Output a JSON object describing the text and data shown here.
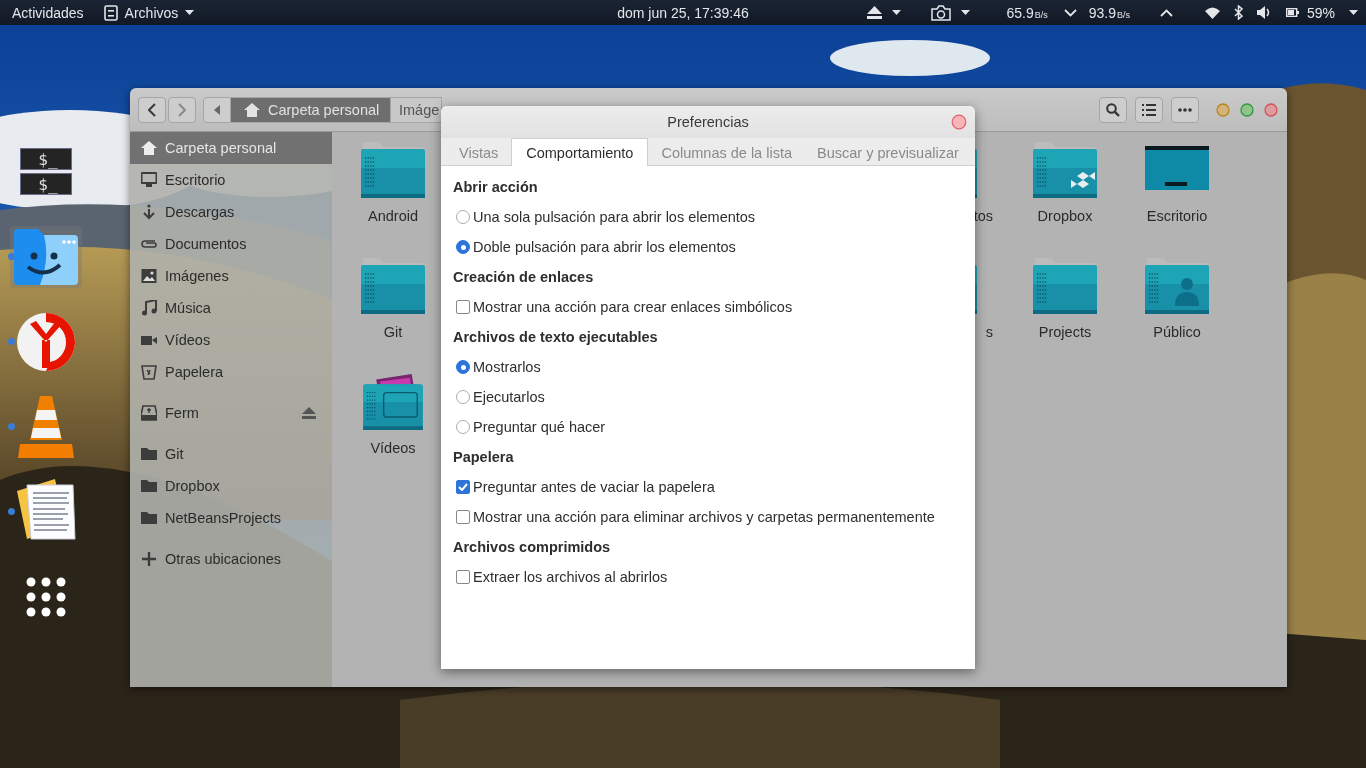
{
  "top_bar": {
    "activities": "Actividades",
    "app_menu": "Archivos",
    "clock": "dom jun 25, 17:39:46",
    "net_down": {
      "value": "65.9",
      "unit": "B/s"
    },
    "net_up": {
      "value": "93.9",
      "unit": "B/s"
    },
    "battery": "59%"
  },
  "dock": [
    {
      "kind": "terminal",
      "prompts": [
        "$_",
        "$_"
      ],
      "running": false,
      "selected": false
    },
    {
      "kind": "finder",
      "running": true,
      "selected": true
    },
    {
      "kind": "browser",
      "running": true,
      "selected": false
    },
    {
      "kind": "cone",
      "running": true,
      "selected": false
    },
    {
      "kind": "notes",
      "running": true,
      "selected": false
    },
    {
      "kind": "apps",
      "running": false,
      "selected": false
    }
  ],
  "files_window": {
    "path": [
      {
        "label": "Carpeta personal",
        "selected": true
      },
      {
        "label": "Imáge",
        "selected": false
      }
    ],
    "sidebar": [
      {
        "items": [
          {
            "kind": "home",
            "label": "Carpeta personal",
            "selected": true,
            "eject": false
          },
          {
            "kind": "desktop",
            "label": "Escritorio",
            "selected": false,
            "eject": false
          },
          {
            "kind": "download",
            "label": "Descargas",
            "selected": false,
            "eject": false
          },
          {
            "kind": "documents",
            "label": "Documentos",
            "selected": false,
            "eject": false
          },
          {
            "kind": "pictures",
            "label": "Imágenes",
            "selected": false,
            "eject": false
          },
          {
            "kind": "music",
            "label": "Música",
            "selected": false,
            "eject": false
          },
          {
            "kind": "videos",
            "label": "Vídeos",
            "selected": false,
            "eject": false
          },
          {
            "kind": "trash",
            "label": "Papelera",
            "selected": false,
            "eject": false
          }
        ]
      },
      {
        "items": [
          {
            "kind": "drive",
            "label": "Ferm",
            "selected": false,
            "eject": true
          }
        ]
      },
      {
        "items": [
          {
            "kind": "folder",
            "label": "Git",
            "selected": false,
            "eject": false
          },
          {
            "kind": "folder",
            "label": "Dropbox",
            "selected": false,
            "eject": false
          },
          {
            "kind": "folder",
            "label": "NetBeansProjects",
            "selected": false,
            "eject": false
          }
        ]
      },
      {
        "items": [
          {
            "kind": "plus",
            "label": "Otras ubicaciones",
            "selected": false,
            "eject": false
          }
        ]
      }
    ],
    "grid_rows": [
      [
        {
          "kind": "folder",
          "label": "Android"
        },
        {
          "kind": "folder",
          "label": "tos"
        },
        {
          "kind": "dropbox",
          "label": "Dropbox"
        },
        {
          "kind": "desktop",
          "label": "Escritorio"
        }
      ],
      [
        {
          "kind": "folder",
          "label": "Git"
        },
        {
          "kind": "folder",
          "label": "s"
        },
        {
          "kind": "folder",
          "label": "Projects"
        },
        {
          "kind": "public",
          "label": "Público"
        }
      ],
      [
        {
          "kind": "videos",
          "label": "Vídeos"
        }
      ]
    ]
  },
  "dialog": {
    "title": "Preferencias",
    "tabs": [
      {
        "label": "Vistas",
        "selected": false
      },
      {
        "label": "Comportamiento",
        "selected": true
      },
      {
        "label": "Columnas de la lista",
        "selected": false
      },
      {
        "label": "Buscar y previsualizar",
        "selected": false
      }
    ],
    "sections": [
      {
        "heading": "Abrir acción",
        "options": [
          {
            "kind": "radio",
            "label": "Una sola pulsación para abrir los elementos",
            "selected": false
          },
          {
            "kind": "radio",
            "label": "Doble pulsación para abrir los elementos",
            "selected": true
          }
        ]
      },
      {
        "heading": "Creación de enlaces",
        "options": [
          {
            "kind": "check",
            "label": "Mostrar una acción para crear enlaces simbólicos",
            "checked": false
          }
        ]
      },
      {
        "heading": "Archivos de texto ejecutables",
        "options": [
          {
            "kind": "radio",
            "label": "Mostrarlos",
            "selected": true
          },
          {
            "kind": "radio",
            "label": "Ejecutarlos",
            "selected": false
          },
          {
            "kind": "radio",
            "label": "Preguntar qué hacer",
            "selected": false
          }
        ]
      },
      {
        "heading": "Papelera",
        "options": [
          {
            "kind": "check",
            "label": "Preguntar antes de vaciar la papelera",
            "checked": true
          },
          {
            "kind": "check",
            "label": "Mostrar una acción para eliminar archivos y carpetas permanentemente",
            "checked": false
          }
        ]
      },
      {
        "heading": "Archivos comprimidos",
        "options": [
          {
            "kind": "check",
            "label": "Extraer los archivos al abrirlos",
            "checked": false
          }
        ]
      }
    ]
  }
}
